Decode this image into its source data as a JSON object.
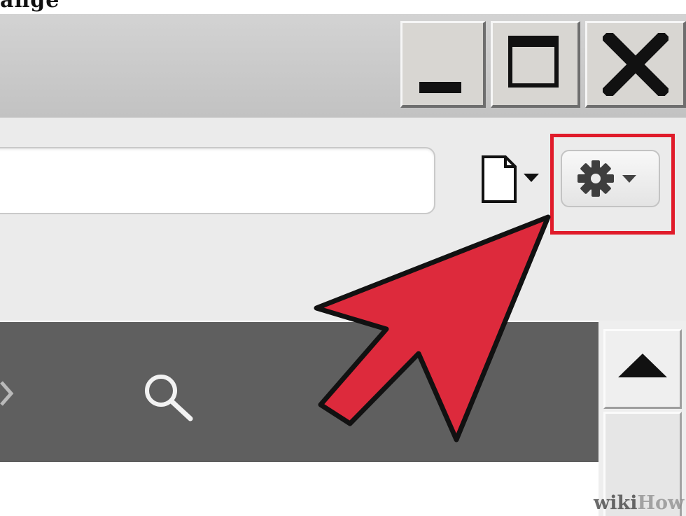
{
  "top_partial_text": "ange",
  "window_controls": {
    "minimize_icon": "minimize-icon",
    "maximize_icon": "maximize-icon",
    "close_icon": "close-icon"
  },
  "toolbar": {
    "address_value": "",
    "page_menu_icon": "page-icon",
    "tools_menu_icon": "gear-icon",
    "dropdown_icon": "chevron-down-icon"
  },
  "search_bar": {
    "search_icon": "search-icon"
  },
  "scrollbar": {
    "up_icon": "arrow-up-icon"
  },
  "annotation": {
    "highlight_color": "#e01b2a",
    "arrow_color": "#dd2a3c"
  },
  "watermark": {
    "part1": "wiki",
    "part2": "How"
  }
}
